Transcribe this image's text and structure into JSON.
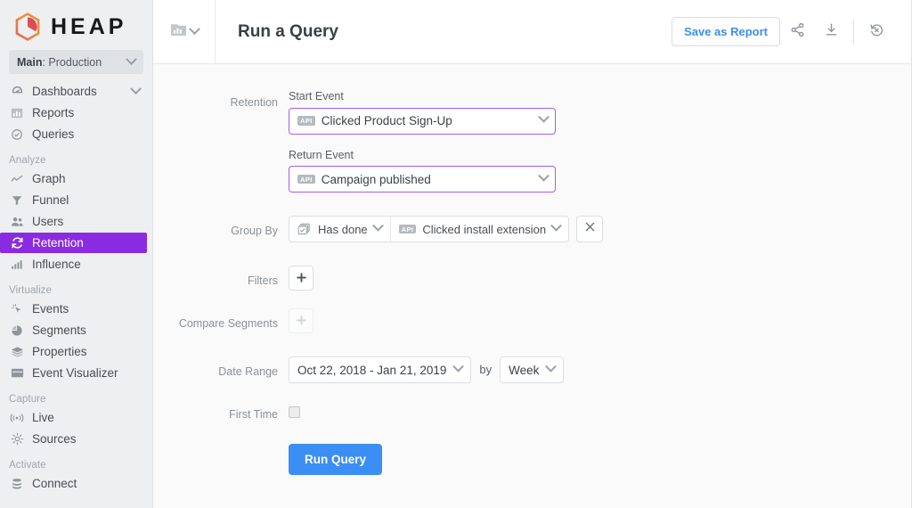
{
  "brand": {
    "logo_icon": "heap-hexagon-logo",
    "name": "HEAP",
    "accent_purple": "#8a2be2",
    "accent_blue": "#3b8ef3",
    "logo_gradient_from": "#f0873f",
    "logo_gradient_to": "#d9414f"
  },
  "sidebar": {
    "env_selector": {
      "main_label": "Main",
      "value_label": ": Production",
      "icon": "chevron-down-icon"
    },
    "top_items": [
      {
        "label": "Dashboards",
        "icon": "dashboard-gauge-icon",
        "has_chevron": true
      },
      {
        "label": "Reports",
        "icon": "bar-chart-icon",
        "has_chevron": false
      },
      {
        "label": "Queries",
        "icon": "clock-check-icon",
        "has_chevron": false
      }
    ],
    "sections": [
      {
        "title": "Analyze",
        "items": [
          {
            "label": "Graph",
            "icon": "line-chart-icon",
            "active": false
          },
          {
            "label": "Funnel",
            "icon": "funnel-icon",
            "active": false
          },
          {
            "label": "Users",
            "icon": "users-icon",
            "active": false
          },
          {
            "label": "Retention",
            "icon": "retention-refresh-icon",
            "active": true
          },
          {
            "label": "Influence",
            "icon": "bar-ascending-icon",
            "active": false
          }
        ]
      },
      {
        "title": "Virtualize",
        "items": [
          {
            "label": "Events",
            "icon": "cursor-click-icon",
            "active": false
          },
          {
            "label": "Segments",
            "icon": "pie-chart-icon",
            "active": false
          },
          {
            "label": "Properties",
            "icon": "layers-icon",
            "active": false
          },
          {
            "label": "Event Visualizer",
            "icon": "window-icon",
            "active": false
          }
        ]
      },
      {
        "title": "Capture",
        "items": [
          {
            "label": "Live",
            "icon": "broadcast-icon",
            "active": false
          },
          {
            "label": "Sources",
            "icon": "sun-rays-icon",
            "active": false
          }
        ]
      },
      {
        "title": "Activate",
        "items": [
          {
            "label": "Connect",
            "icon": "database-stack-icon",
            "active": false
          }
        ]
      }
    ]
  },
  "topbar": {
    "view_icon": "report-chart-icon",
    "view_chevron_icon": "chevron-down-icon",
    "title": "Run a Query",
    "save_label": "Save as Report",
    "share_icon": "share-icon",
    "download_icon": "download-icon",
    "reset_icon": "reset-clock-icon"
  },
  "form": {
    "retention": {
      "label": "Retention",
      "start_event": {
        "sub_label": "Start Event",
        "badge": "API",
        "value": "Clicked Product Sign-Up",
        "chevron_icon": "chevron-down-icon"
      },
      "return_event": {
        "sub_label": "Return Event",
        "badge": "API",
        "value": "Campaign published",
        "chevron_icon": "chevron-down-icon"
      }
    },
    "group_by": {
      "label": "Group By",
      "condition": {
        "icon": "checkbox-stack-icon",
        "value": "Has done",
        "chevron_icon": "chevron-down-icon"
      },
      "event": {
        "badge": "API",
        "value": "Clicked install extension",
        "chevron_icon": "chevron-down-icon"
      },
      "remove_icon": "close-x-icon"
    },
    "filters": {
      "label": "Filters",
      "add_label": "+",
      "add_icon": "plus-icon",
      "disabled": false
    },
    "compare_segments": {
      "label": "Compare Segments",
      "add_label": "+",
      "add_icon": "plus-icon",
      "disabled": true
    },
    "date_range": {
      "label": "Date Range",
      "value": "Oct 22, 2018 - Jan 21, 2019",
      "chevron_icon": "chevron-down-icon",
      "by_text": "by",
      "interval_value": "Week",
      "interval_chevron_icon": "chevron-down-icon"
    },
    "first_time": {
      "label": "First Time",
      "checked": false
    },
    "run_button": "Run Query"
  }
}
